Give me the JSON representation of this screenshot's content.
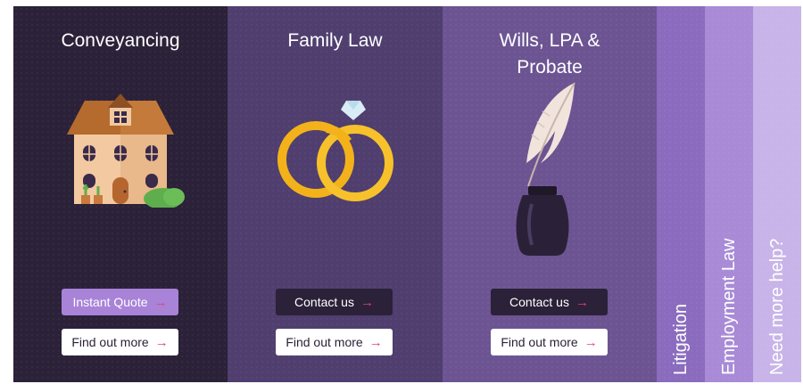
{
  "panels": [
    {
      "title": "Conveyancing",
      "illustration": "house-illustration",
      "primary_button": "Instant Quote",
      "secondary_button": "Find out more"
    },
    {
      "title": "Family Law",
      "illustration": "wedding-rings-illustration",
      "primary_button": "Contact us",
      "secondary_button": "Find out more"
    },
    {
      "title": "Wills, LPA &\nProbate",
      "illustration": "quill-inkpot-illustration",
      "primary_button": "Contact us",
      "secondary_button": "Find out more"
    }
  ],
  "collapsed_tabs": [
    {
      "label": "Litigation"
    },
    {
      "label": "Employment Law"
    },
    {
      "label": "Need more help?"
    }
  ],
  "icons": {
    "arrow": "→"
  },
  "colors": {
    "panel1": "#2b2138",
    "panel2": "#4f3e6e",
    "panel3": "#6c5492",
    "panel4": "#8a6bbd",
    "panel5": "#a88ad6",
    "panel6": "#c8b4e8",
    "accent_pink": "#e0417a",
    "quote_button": "#a883d8"
  }
}
